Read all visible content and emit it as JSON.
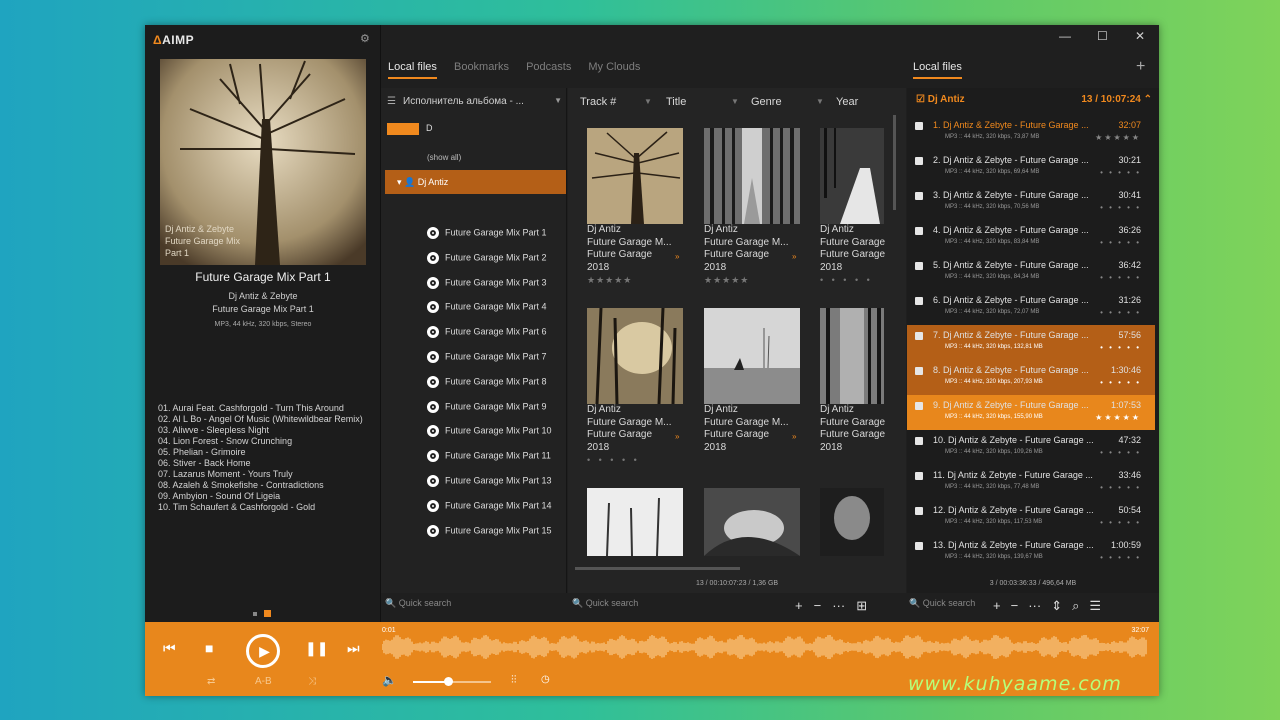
{
  "app": {
    "logo": "AIMP",
    "logo_mark": "Δ"
  },
  "window": {
    "minimize": "—",
    "maximize": "☐",
    "close": "✕"
  },
  "now_playing": {
    "cover_caption": [
      "Dj Antiz & Zebyte",
      "Future Garage Mix",
      "Part 1"
    ],
    "title": "Future Garage Mix Part 1",
    "artist": "Dj Antiz & Zebyte",
    "album": "Future Garage Mix Part 1",
    "info": "MP3, 44 kHz, 320 kbps, Stereo",
    "tracks": [
      "01. Aurai Feat. Cashforgold - Turn This Around",
      "02. Al L Bo - Angel Of Music (Whitewildbear Remix)",
      "03. Aliwve - Sleepless Night",
      "04. Lion Forest - Snow Crunching",
      "05. Phelian - Grimoire",
      "06. Stiver - Back Home",
      "07. Lazarus Moment - Yours Truly",
      "08. Azaleh & Smokefishe - Contradictions",
      "09. Ambyion - Sound Of Ligeia",
      "10. Tim Schaufert & Cashforgold - Gold"
    ]
  },
  "tabs": [
    "Local files",
    "Bookmarks",
    "Podcasts",
    "My Clouds"
  ],
  "right_tab": "Local files",
  "tree": {
    "header": "Исполнитель альбома - ...",
    "letter": "D",
    "show_all": "(show all)",
    "artist": "Dj Antiz",
    "items": [
      "Future Garage Mix Part 1",
      "Future Garage Mix Part 2",
      "Future Garage Mix Part 3",
      "Future Garage Mix Part 4",
      "Future Garage Mix Part 6",
      "Future Garage Mix Part 7",
      "Future Garage Mix Part 8",
      "Future Garage Mix Part 9",
      "Future Garage Mix Part 10",
      "Future Garage Mix Part 11",
      "Future Garage Mix Part 13",
      "Future Garage Mix Part 14",
      "Future Garage Mix Part 15"
    ],
    "search_placeholder": "Quick search"
  },
  "grid": {
    "columns": [
      "Track #",
      "Title",
      "Genre",
      "Year"
    ],
    "albums": [
      {
        "artist": "Dj Antiz",
        "title": "Future Garage M...",
        "genre": "Future Garage",
        "year": "2018",
        "rating": "★★★★★"
      },
      {
        "artist": "Dj Antiz",
        "title": "Future Garage M...",
        "genre": "Future Garage",
        "year": "2018",
        "rating": "★★★★★"
      },
      {
        "artist": "Dj Antiz",
        "title": "Future Garage",
        "genre": "Future Garage",
        "year": "2018",
        "rating": "• • • • •"
      },
      {
        "artist": "Dj Antiz",
        "title": "Future Garage M...",
        "genre": "Future Garage",
        "year": "2018",
        "rating": "• • • • •"
      },
      {
        "artist": "Dj Antiz",
        "title": "Future Garage M...",
        "genre": "Future Garage",
        "year": "2018",
        "rating": ""
      },
      {
        "artist": "Dj Antiz",
        "title": "Future Garage",
        "genre": "Future Garage",
        "year": "2018",
        "rating": ""
      }
    ],
    "status": "13 / 00:10:07:23 / 1,36 GB",
    "search_placeholder": "Quick search"
  },
  "playlist": {
    "header": "Dj Antiz",
    "count": "13 / 10:07:24",
    "rows": [
      {
        "name": "1. Dj Antiz & Zebyte - Future Garage ...",
        "dur": "32:07",
        "info": "MP3 :: 44 kHz, 320 kbps, 73,87 MB",
        "rate": "★★★★★"
      },
      {
        "name": "2. Dj Antiz & Zebyte - Future Garage ...",
        "dur": "30:21",
        "info": "MP3 :: 44 kHz, 320 kbps, 69,64 MB",
        "rate": "• • • • •"
      },
      {
        "name": "3. Dj Antiz & Zebyte - Future Garage ...",
        "dur": "30:41",
        "info": "MP3 :: 44 kHz, 320 kbps, 70,56 MB",
        "rate": "• • • • •"
      },
      {
        "name": "4. Dj Antiz & Zebyte - Future Garage ...",
        "dur": "36:26",
        "info": "MP3 :: 44 kHz, 320 kbps, 83,84 MB",
        "rate": "• • • • •"
      },
      {
        "name": "5. Dj Antiz & Zebyte - Future Garage ...",
        "dur": "36:42",
        "info": "MP3 :: 44 kHz, 320 kbps, 84,34 MB",
        "rate": "• • • • •"
      },
      {
        "name": "6. Dj Antiz & Zebyte - Future Garage ...",
        "dur": "31:26",
        "info": "MP3 :: 44 kHz, 320 kbps, 72,07 MB",
        "rate": "• • • • •"
      },
      {
        "name": "7. Dj Antiz & Zebyte - Future Garage ...",
        "dur": "57:56",
        "info": "MP3 :: 44 kHz, 320 kbps, 132,81 MB",
        "rate": "• • • • •"
      },
      {
        "name": "8. Dj Antiz & Zebyte - Future Garage ...",
        "dur": "1:30:46",
        "info": "MP3 :: 44 kHz, 320 kbps, 207,93 MB",
        "rate": "• • • • •"
      },
      {
        "name": "9. Dj Antiz & Zebyte - Future Garage ...",
        "dur": "1:07:53",
        "info": "MP3 :: 44 kHz, 320 kbps, 155,90 MB",
        "rate": "★★★★★"
      },
      {
        "name": "10. Dj Antiz & Zebyte - Future Garage ...",
        "dur": "47:32",
        "info": "MP3 :: 44 kHz, 320 kbps, 109,26 MB",
        "rate": "• • • • •"
      },
      {
        "name": "11. Dj Antiz & Zebyte - Future Garage ...",
        "dur": "33:46",
        "info": "MP3 :: 44 kHz, 320 kbps, 77,48 MB",
        "rate": "• • • • •"
      },
      {
        "name": "12. Dj Antiz & Zebyte - Future Garage ...",
        "dur": "50:54",
        "info": "MP3 :: 44 kHz, 320 kbps, 117,53 MB",
        "rate": "• • • • •"
      },
      {
        "name": "13. Dj Antiz & Zebyte - Future Garage ...",
        "dur": "1:00:59",
        "info": "MP3 :: 44 kHz, 320 kbps, 139,67 MB",
        "rate": "• • • • •"
      }
    ],
    "status": "3 / 00:03:36:33 / 496,64 MB",
    "search_placeholder": "Quick search"
  },
  "player": {
    "time_elapsed": "0:01",
    "time_total": "32:07",
    "ab_label": "A-B",
    "volume": 0.45
  },
  "watermark": "www.kuhyaame.com",
  "colors": {
    "accent": "#e8871c",
    "accent_dark": "#b45f17",
    "bg": "#1f1f1f"
  }
}
